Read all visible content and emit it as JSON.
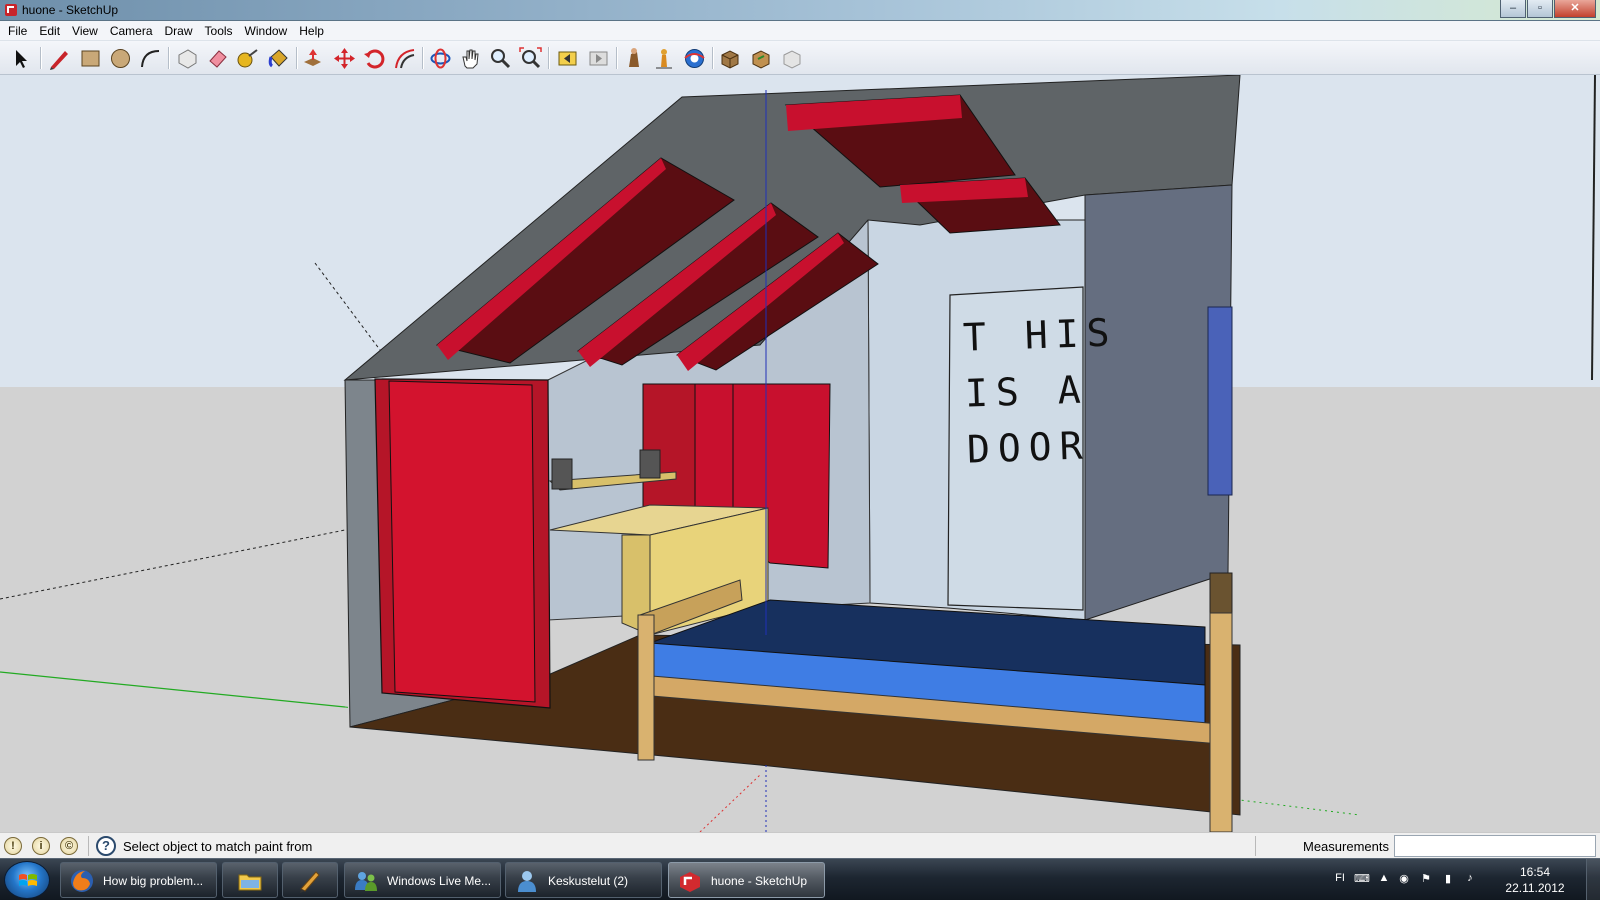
{
  "window": {
    "title": "huone - SketchUp",
    "minimize": "–",
    "maximize": "▫",
    "close": "✕"
  },
  "menu": [
    "File",
    "Edit",
    "View",
    "Camera",
    "Draw",
    "Tools",
    "Window",
    "Help"
  ],
  "toolbar": {
    "tools": [
      "select",
      "pencil",
      "rectangle",
      "circle",
      "arc",
      "make-component",
      "eraser",
      "tape-measure",
      "paint-bucket",
      "push-pull",
      "move",
      "rotate",
      "offset",
      "orbit",
      "pan",
      "zoom",
      "zoom-extents",
      "previous-view",
      "next-view",
      "walk",
      "position-camera",
      "look-around",
      "component-window",
      "3d-warehouse",
      "share-model"
    ]
  },
  "scene": {
    "wall_note": "T HIS\nIS A\nDOOR"
  },
  "status": {
    "icons": [
      "!",
      "i",
      "©"
    ],
    "help_icon": "?",
    "message": "Select object to match paint from",
    "measurements_label": "Measurements",
    "measurements_value": ""
  },
  "taskbar": {
    "items": [
      {
        "label": "How big problem...",
        "icon": "firefox-icon"
      },
      {
        "label": "",
        "icon": "folder-icon"
      },
      {
        "label": "",
        "icon": "sketchup-pencil-icon"
      },
      {
        "label": "Windows Live Me...",
        "icon": "live-messenger-icon"
      },
      {
        "label": "Keskustelut (2)",
        "icon": "chat-icon"
      },
      {
        "label": "huone - SketchUp",
        "icon": "sketchup-icon"
      }
    ],
    "language": "FI",
    "time": "16:54",
    "date": "22.11.2012"
  }
}
